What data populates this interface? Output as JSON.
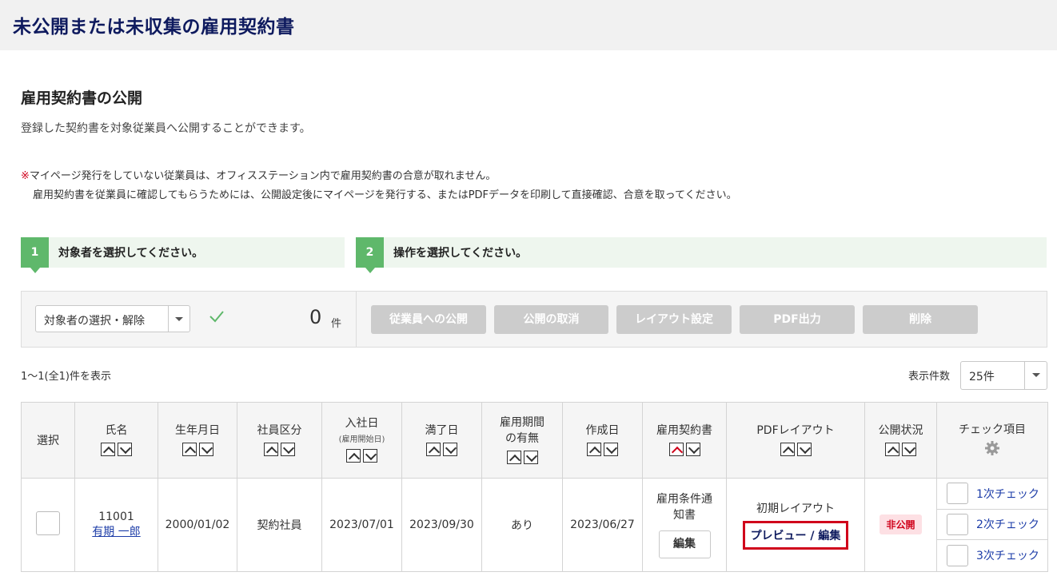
{
  "header": {
    "title": "未公開または未収集の雇用契約書"
  },
  "section": {
    "title": "雇用契約書の公開",
    "description": "登録した契約書を対象従業員へ公開することができます。",
    "note_mark": "※",
    "note_line1": "マイページ発行をしていない従業員は、オフィスステーション内で雇用契約書の合意が取れません。",
    "note_line2": "雇用契約書を従業員に確認してもらうためには、公開設定後にマイページを発行する、またはPDFデータを印刷して直接確認、合意を取ってください。"
  },
  "steps": [
    {
      "num": "1",
      "label": "対象者を選択してください。"
    },
    {
      "num": "2",
      "label": "操作を選択してください。"
    }
  ],
  "selection": {
    "dropdown_label": "対象者の選択・解除",
    "count": "0",
    "count_unit": "件"
  },
  "actions": [
    "従業員への公開",
    "公開の取消",
    "レイアウト設定",
    "PDF出力",
    "削除"
  ],
  "listing": {
    "range_text": "1〜1(全1)件を表示",
    "perpage_label": "表示件数",
    "perpage_value": "25件"
  },
  "table": {
    "headers": {
      "select": "選択",
      "name": "氏名",
      "birth": "生年月日",
      "category": "社員区分",
      "joined": "入社日",
      "joined_sub": "(雇用開始日)",
      "end": "満了日",
      "period_1": "雇用期間",
      "period_2": "の有無",
      "created": "作成日",
      "contract": "雇用契約書",
      "pdf": "PDFレイアウト",
      "status": "公開状況",
      "checks": "チェック項目"
    },
    "rows": [
      {
        "id": "11001",
        "name": "有期 一郎",
        "birth": "2000/01/02",
        "category": "契約社員",
        "joined": "2023/07/01",
        "end": "2023/09/30",
        "period": "あり",
        "created": "2023/06/27",
        "contract_1": "雇用条件通",
        "contract_2": "知書",
        "edit": "編集",
        "layout": "初期レイアウト",
        "preview": "プレビュー / 編集",
        "status": "非公開",
        "checks": [
          "1次チェック",
          "2次チェック",
          "3次チェック"
        ]
      }
    ]
  },
  "colors": {
    "title_navy": "#0e1a5e",
    "step_green": "#5fb86b",
    "disabled_gray": "#cccccc",
    "alert_red": "#d0021b",
    "link_blue": "#1d3da8"
  }
}
